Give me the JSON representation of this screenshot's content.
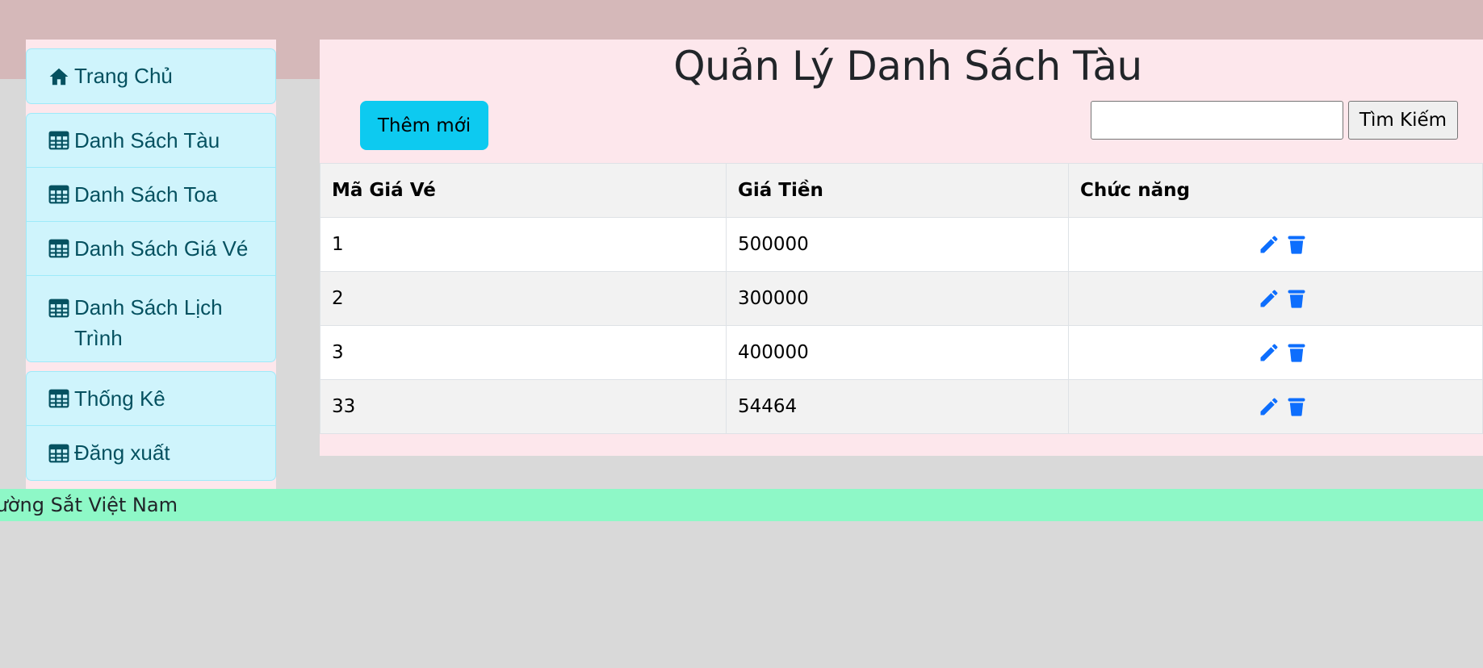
{
  "sidebar": {
    "home": {
      "label": "Trang Chủ",
      "icon": "home-icon"
    },
    "lists": [
      {
        "label": "Danh Sách Tàu",
        "icon": "table-icon"
      },
      {
        "label": "Danh Sách Toa",
        "icon": "table-icon"
      },
      {
        "label": "Danh Sách Giá Vé",
        "icon": "table-icon"
      },
      {
        "label": "Danh Sách Lịch Trình",
        "icon": "table-icon"
      }
    ],
    "others": [
      {
        "label": "Thống Kê",
        "icon": "table-icon"
      },
      {
        "label": "Đăng xuất",
        "icon": "table-icon"
      }
    ]
  },
  "main": {
    "title": "Quản Lý Danh Sách Tàu",
    "add_label": "Thêm mới",
    "search": {
      "value": "",
      "button_label": "Tìm Kiếm"
    },
    "table": {
      "headers": [
        "Mã Giá Vé",
        "Giá Tiền",
        "Chức năng"
      ],
      "rows": [
        {
          "id": "1",
          "price": "500000"
        },
        {
          "id": "2",
          "price": "300000"
        },
        {
          "id": "3",
          "price": "400000"
        },
        {
          "id": "33",
          "price": "54464"
        }
      ]
    }
  },
  "footer": {
    "text": "Đường Sắt Việt Nam"
  },
  "colors": {
    "accent": "#0dcaf0",
    "nav_bg": "#cff4fc",
    "nav_text": "#055160",
    "action_icon": "#0d6efd",
    "footer_bg": "#8ef8c7",
    "top_band": "#d5b8b9",
    "panel_bg": "#fde7ec"
  }
}
